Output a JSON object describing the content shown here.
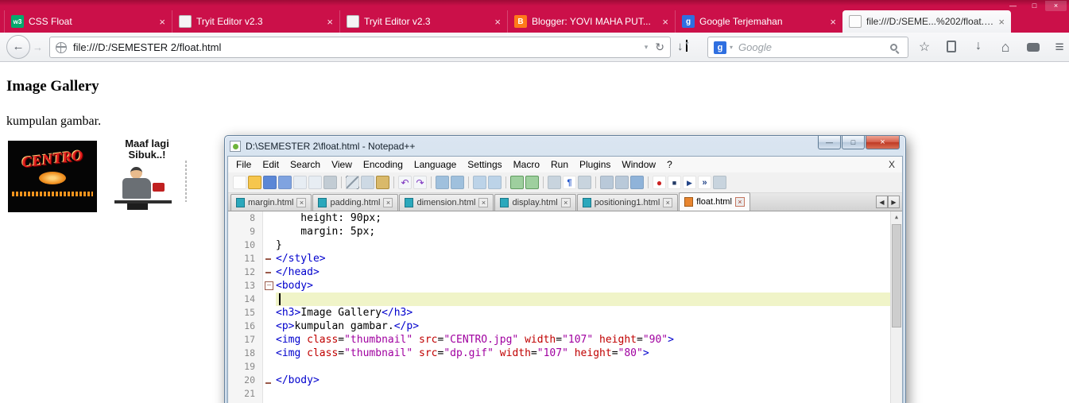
{
  "colors": {
    "titlebar_red": "#cb1049",
    "syntax_tag": "#0000cd",
    "syntax_attr": "#c00000",
    "syntax_value": "#a000a0",
    "current_line_highlight": "#f0f4c8"
  },
  "browser": {
    "window_controls": {
      "minimize": "—",
      "maximize": "□",
      "close": "×"
    },
    "tab_close_glyph": "×",
    "tabs": [
      {
        "title": "CSS Float",
        "favicon": "w3"
      },
      {
        "title": "Tryit Editor v2.3",
        "favicon": ""
      },
      {
        "title": "Tryit Editor v2.3",
        "favicon": ""
      },
      {
        "title": "Blogger: YOVI MAHA PUT...",
        "favicon": "B"
      },
      {
        "title": "Google Terjemahan",
        "favicon": "g"
      },
      {
        "title": "file:///D:/SEME...%202/float.html",
        "favicon": ""
      }
    ],
    "nav": {
      "back_glyph": "←",
      "forward_glyph": "→",
      "url": "file:///D:/SEMESTER 2/float.html",
      "url_dropdown_glyph": "▾",
      "reload_glyph": "↻",
      "download_glyph": "↓",
      "download_caret_glyph": "▾",
      "search_engine_letter": "g",
      "search_caret_glyph": "▾",
      "search_placeholder": "Google",
      "bookmark_star_glyph": "☆",
      "downloads_glyph": "↓",
      "home_glyph": "⌂",
      "menu_glyph": "≡"
    }
  },
  "page": {
    "heading": "Image Gallery",
    "paragraph": "kumpulan gambar.",
    "centro_image_text": "CENTRO",
    "dp_image_text_line1": "Maaf lagi",
    "dp_image_text_line2": "Sibuk..!"
  },
  "notepadpp": {
    "title": "D:\\SEMESTER 2\\float.html - Notepad++",
    "window_controls": {
      "minimize": "—",
      "maximize": "□",
      "close": "×"
    },
    "menu": [
      "File",
      "Edit",
      "Search",
      "View",
      "Encoding",
      "Language",
      "Settings",
      "Macro",
      "Run",
      "Plugins",
      "Window",
      "?"
    ],
    "menu_right": "X",
    "toolbar": [
      {
        "name": "new-file"
      },
      {
        "name": "open"
      },
      {
        "name": "save"
      },
      {
        "name": "save-all"
      },
      {
        "name": "close"
      },
      {
        "name": "close-all"
      },
      {
        "name": "print"
      },
      {
        "name": "separator"
      },
      {
        "name": "cut"
      },
      {
        "name": "copy"
      },
      {
        "name": "paste"
      },
      {
        "name": "separator"
      },
      {
        "name": "undo",
        "glyph": "↶"
      },
      {
        "name": "redo",
        "glyph": "↷"
      },
      {
        "name": "separator"
      },
      {
        "name": "find"
      },
      {
        "name": "replace"
      },
      {
        "name": "separator"
      },
      {
        "name": "zoom-in"
      },
      {
        "name": "zoom-out"
      },
      {
        "name": "separator"
      },
      {
        "name": "sync-vertical"
      },
      {
        "name": "sync-horizontal"
      },
      {
        "name": "separator"
      },
      {
        "name": "word-wrap"
      },
      {
        "name": "show-all-characters",
        "glyph": "¶"
      },
      {
        "name": "indent-guide"
      },
      {
        "name": "separator"
      },
      {
        "name": "doc-map"
      },
      {
        "name": "function-list"
      },
      {
        "name": "monitor"
      },
      {
        "name": "separator"
      },
      {
        "name": "record-macro",
        "glyph": "●"
      },
      {
        "name": "stop-record",
        "glyph": "■"
      },
      {
        "name": "playback-macro",
        "glyph": "▶"
      },
      {
        "name": "run-macro-multiple",
        "glyph": "»"
      },
      {
        "name": "save-macro"
      }
    ],
    "doc_tabs": [
      {
        "label": "margin.html",
        "active": false
      },
      {
        "label": "padding.html",
        "active": false
      },
      {
        "label": "dimension.html",
        "active": false
      },
      {
        "label": "display.html",
        "active": false
      },
      {
        "label": "positioning1.html",
        "active": false
      },
      {
        "label": "float.html",
        "active": true
      }
    ],
    "tab_close_glyph": "×",
    "pager_left_glyph": "◀",
    "pager_right_glyph": "▶",
    "scrollbar_up_glyph": "▲",
    "editor": {
      "lines": [
        {
          "no": "8",
          "tokens": [
            {
              "t": "    height: 90px;",
              "c": "plain"
            }
          ]
        },
        {
          "no": "9",
          "tokens": [
            {
              "t": "    margin: 5px;",
              "c": "plain"
            }
          ]
        },
        {
          "no": "10",
          "tokens": [
            {
              "t": "}",
              "c": "plain"
            }
          ]
        },
        {
          "no": "11",
          "fold": "dash",
          "tokens": [
            {
              "t": "</style>",
              "c": "tag"
            }
          ]
        },
        {
          "no": "12",
          "fold": "dash",
          "tokens": [
            {
              "t": "</head>",
              "c": "tag"
            }
          ]
        },
        {
          "no": "13",
          "fold": "box",
          "tokens": [
            {
              "t": "<body>",
              "c": "tag"
            }
          ]
        },
        {
          "no": "14",
          "current": true,
          "tokens": []
        },
        {
          "no": "15",
          "tokens": [
            {
              "t": "<h3>",
              "c": "tag"
            },
            {
              "t": "Image Gallery",
              "c": "plain"
            },
            {
              "t": "</h3>",
              "c": "tag"
            }
          ]
        },
        {
          "no": "16",
          "tokens": [
            {
              "t": "<p>",
              "c": "tag"
            },
            {
              "t": "kumpulan gambar.",
              "c": "plain"
            },
            {
              "t": "</p>",
              "c": "tag"
            }
          ]
        },
        {
          "no": "17",
          "tokens": [
            {
              "t": "<img ",
              "c": "tag"
            },
            {
              "t": "class",
              "c": "attr"
            },
            {
              "t": "=",
              "c": "plain"
            },
            {
              "t": "\"thumbnail\"",
              "c": "val"
            },
            {
              "t": " ",
              "c": "plain"
            },
            {
              "t": "src",
              "c": "attr"
            },
            {
              "t": "=",
              "c": "plain"
            },
            {
              "t": "\"CENTRO.jpg\"",
              "c": "val"
            },
            {
              "t": " ",
              "c": "plain"
            },
            {
              "t": "width",
              "c": "attr"
            },
            {
              "t": "=",
              "c": "plain"
            },
            {
              "t": "\"107\"",
              "c": "val"
            },
            {
              "t": " ",
              "c": "plain"
            },
            {
              "t": "height",
              "c": "attr"
            },
            {
              "t": "=",
              "c": "plain"
            },
            {
              "t": "\"90\"",
              "c": "val"
            },
            {
              "t": ">",
              "c": "tag"
            }
          ]
        },
        {
          "no": "18",
          "tokens": [
            {
              "t": "<img ",
              "c": "tag"
            },
            {
              "t": "class",
              "c": "attr"
            },
            {
              "t": "=",
              "c": "plain"
            },
            {
              "t": "\"thumbnail\"",
              "c": "val"
            },
            {
              "t": " ",
              "c": "plain"
            },
            {
              "t": "src",
              "c": "attr"
            },
            {
              "t": "=",
              "c": "plain"
            },
            {
              "t": "\"dp.gif\"",
              "c": "val"
            },
            {
              "t": " ",
              "c": "plain"
            },
            {
              "t": "width",
              "c": "attr"
            },
            {
              "t": "=",
              "c": "plain"
            },
            {
              "t": "\"107\"",
              "c": "val"
            },
            {
              "t": " ",
              "c": "plain"
            },
            {
              "t": "height",
              "c": "attr"
            },
            {
              "t": "=",
              "c": "plain"
            },
            {
              "t": "\"80\"",
              "c": "val"
            },
            {
              "t": ">",
              "c": "tag"
            }
          ]
        },
        {
          "no": "19",
          "tokens": []
        },
        {
          "no": "20",
          "fold": "dash",
          "tokens": [
            {
              "t": "</body>",
              "c": "tag"
            }
          ]
        },
        {
          "no": "21",
          "tokens": []
        }
      ]
    }
  }
}
